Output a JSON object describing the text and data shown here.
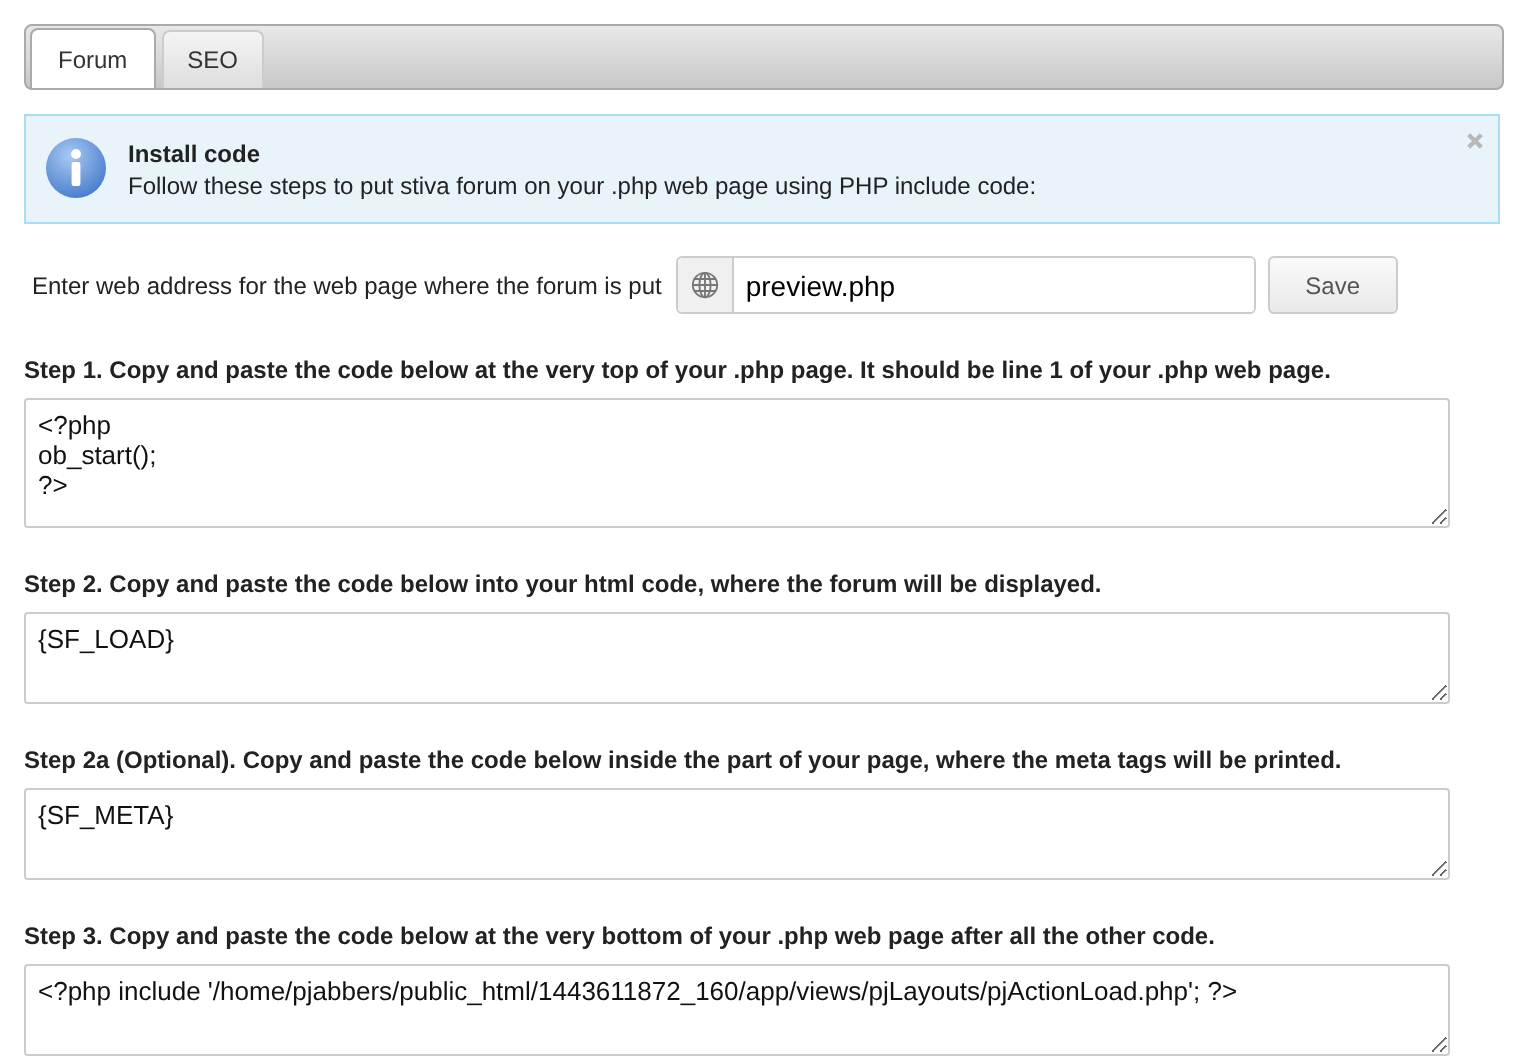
{
  "tabs": [
    {
      "label": "Forum",
      "selected": true
    },
    {
      "label": "SEO",
      "selected": false
    }
  ],
  "notice": {
    "title": "Install code",
    "text": "Follow these steps to put stiva forum on your .php web page using PHP include code:",
    "closable": true
  },
  "address": {
    "label": "Enter web address for the web page where the forum is put",
    "value": "preview.php",
    "button": "Save"
  },
  "steps": [
    {
      "label": "Step 1. Copy and paste the code below at the very top of your .php page. It should be line 1 of your .php web page.",
      "code": "<?php\nob_start();\n?>"
    },
    {
      "label": "Step 2. Copy and paste the code below into your html code, where the forum will be displayed.",
      "code": "{SF_LOAD}"
    },
    {
      "label": "Step 2a (Optional). Copy and paste the code below inside the part of your page, where the meta tags will be printed.",
      "code": "{SF_META}"
    },
    {
      "label": "Step 3. Copy and paste the code below at the very bottom of your .php web page after all the other code.",
      "code": "<?php include '/home/pjabbers/public_html/1443611872_160/app/views/pjLayouts/pjActionLoad.php'; ?>"
    }
  ]
}
